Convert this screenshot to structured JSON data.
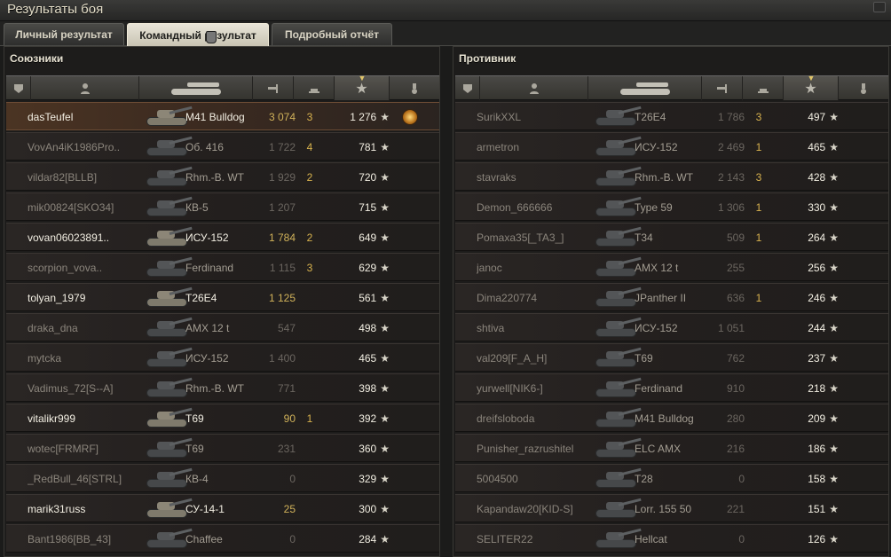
{
  "window": {
    "title": "Результаты боя"
  },
  "tabs": [
    {
      "label": "Личный результат"
    },
    {
      "label": "Командный результат"
    },
    {
      "label": "Подробный отчёт"
    }
  ],
  "allies": {
    "title": "Союзники",
    "rows": [
      {
        "player": "dasTeufel",
        "vehicle": "M41 Bulldog",
        "damage": "3 074",
        "kills": "3",
        "xp": "1 276",
        "self": true,
        "medal": true
      },
      {
        "player": "VovAn4iK1986Pro..",
        "vehicle": "Об. 416",
        "damage": "1 722",
        "kills": "4",
        "xp": "781"
      },
      {
        "player": "vildar82[BLLB]",
        "vehicle": "Rhm.-B. WT",
        "damage": "1 929",
        "kills": "2",
        "xp": "720"
      },
      {
        "player": "mik00824[SKO34]",
        "vehicle": "КВ-5",
        "damage": "1 207",
        "kills": "",
        "xp": "715"
      },
      {
        "player": "vovan06023891..",
        "vehicle": "ИСУ-152",
        "damage": "1 784",
        "kills": "2",
        "xp": "649",
        "bright": true
      },
      {
        "player": "scorpion_vova..",
        "vehicle": "Ferdinand",
        "damage": "1 115",
        "kills": "3",
        "xp": "629"
      },
      {
        "player": "tolyan_1979",
        "vehicle": "T26E4",
        "damage": "1 125",
        "kills": "",
        "xp": "561",
        "bright": true
      },
      {
        "player": "draka_dna",
        "vehicle": "AMX 12 t",
        "damage": "547",
        "kills": "",
        "xp": "498"
      },
      {
        "player": "mytcka",
        "vehicle": "ИСУ-152",
        "damage": "1 400",
        "kills": "",
        "xp": "465"
      },
      {
        "player": "Vadimus_72[S--A]",
        "vehicle": "Rhm.-B. WT",
        "damage": "771",
        "kills": "",
        "xp": "398"
      },
      {
        "player": "vitalikr999",
        "vehicle": "T69",
        "damage": "90",
        "kills": "1",
        "xp": "392",
        "bright": true
      },
      {
        "player": "wotec[FRMRF]",
        "vehicle": "T69",
        "damage": "231",
        "kills": "",
        "xp": "360"
      },
      {
        "player": "_RedBull_46[STRL]",
        "vehicle": "КВ-4",
        "damage": "0",
        "kills": "",
        "xp": "329"
      },
      {
        "player": "marik31russ",
        "vehicle": "СУ-14-1",
        "damage": "25",
        "kills": "",
        "xp": "300",
        "bright": true
      },
      {
        "player": "Bant1986[BB_43]",
        "vehicle": "Chaffee",
        "damage": "0",
        "kills": "",
        "xp": "284"
      }
    ]
  },
  "enemies": {
    "title": "Противник",
    "rows": [
      {
        "player": "SurikXXL",
        "vehicle": "T26E4",
        "damage": "1 786",
        "kills": "3",
        "xp": "497"
      },
      {
        "player": "armetron",
        "vehicle": "ИСУ-152",
        "damage": "2 469",
        "kills": "1",
        "xp": "465"
      },
      {
        "player": "stavraks",
        "vehicle": "Rhm.-B. WT",
        "damage": "2 143",
        "kills": "3",
        "xp": "428"
      },
      {
        "player": "Demon_666666",
        "vehicle": "Type 59",
        "damage": "1 306",
        "kills": "1",
        "xp": "330"
      },
      {
        "player": "Pomaxa35[_TA3_]",
        "vehicle": "T34",
        "damage": "509",
        "kills": "1",
        "xp": "264"
      },
      {
        "player": "janoc",
        "vehicle": "AMX 12 t",
        "damage": "255",
        "kills": "",
        "xp": "256"
      },
      {
        "player": "Dima220774",
        "vehicle": "JPanther II",
        "damage": "636",
        "kills": "1",
        "xp": "246"
      },
      {
        "player": "shtiva",
        "vehicle": "ИСУ-152",
        "damage": "1 051",
        "kills": "",
        "xp": "244"
      },
      {
        "player": "val209[F_A_H]",
        "vehicle": "T69",
        "damage": "762",
        "kills": "",
        "xp": "237"
      },
      {
        "player": "yurwell[NIK6-]",
        "vehicle": "Ferdinand",
        "damage": "910",
        "kills": "",
        "xp": "218"
      },
      {
        "player": "dreifsloboda",
        "vehicle": "M41 Bulldog",
        "damage": "280",
        "kills": "",
        "xp": "209"
      },
      {
        "player": "Punisher_razrushitel",
        "vehicle": "ELC AMX",
        "damage": "216",
        "kills": "",
        "xp": "186"
      },
      {
        "player": "5004500",
        "vehicle": "T28",
        "damage": "0",
        "kills": "",
        "xp": "158"
      },
      {
        "player": "Kapandaw20[KID-S]",
        "vehicle": "Lorr. 155 50",
        "damage": "221",
        "kills": "",
        "xp": "151"
      },
      {
        "player": "SELITER22",
        "vehicle": "Hellcat",
        "damage": "0",
        "kills": "",
        "xp": "126"
      }
    ]
  },
  "colors": {
    "accent": "#d0b25a",
    "self_row": "#4b3423"
  }
}
